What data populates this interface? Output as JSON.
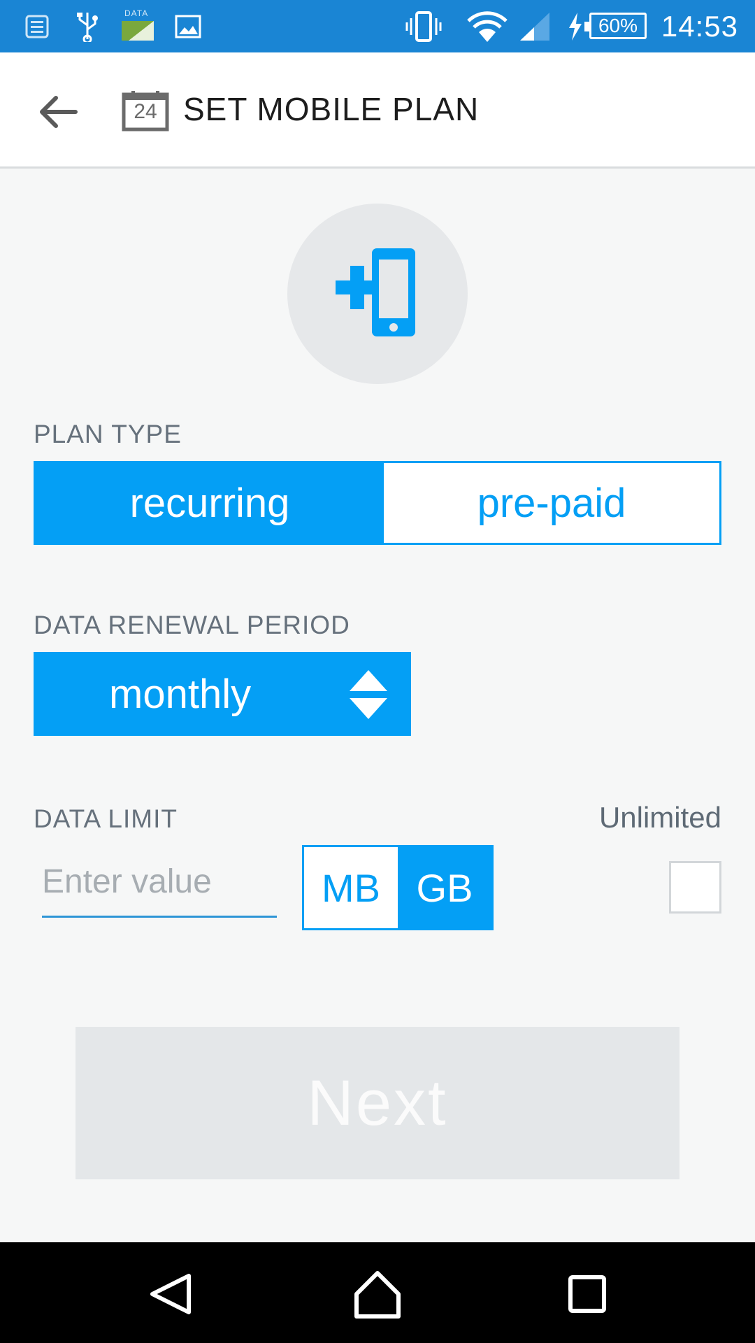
{
  "status_bar": {
    "time": "14:53",
    "battery": "60%",
    "data_label": "DATA",
    "icons": [
      "notes-icon",
      "usb-icon",
      "data-icon",
      "image-icon",
      "vibrate-icon",
      "wifi-icon",
      "signal-icon",
      "charging-icon"
    ]
  },
  "app_bar": {
    "title": "SET MOBILE PLAN",
    "calendar_day": "24",
    "back_icon": "arrow-left-icon"
  },
  "hero": {
    "icon": "add-phone-icon"
  },
  "plan_type": {
    "label": "PLAN TYPE",
    "options": [
      "recurring",
      "pre-paid"
    ],
    "selected": "recurring"
  },
  "renewal": {
    "label": "DATA RENEWAL PERIOD",
    "value": "monthly"
  },
  "data_limit": {
    "label": "DATA LIMIT",
    "placeholder": "Enter value",
    "value": "",
    "units": [
      "MB",
      "GB"
    ],
    "selected_unit": "GB",
    "unlimited_label": "Unlimited",
    "unlimited_checked": false
  },
  "next_label": "Next",
  "colors": {
    "accent": "#049ff5",
    "status_bar": "#1a85d4",
    "disabled_button": "#e4e7e9"
  }
}
